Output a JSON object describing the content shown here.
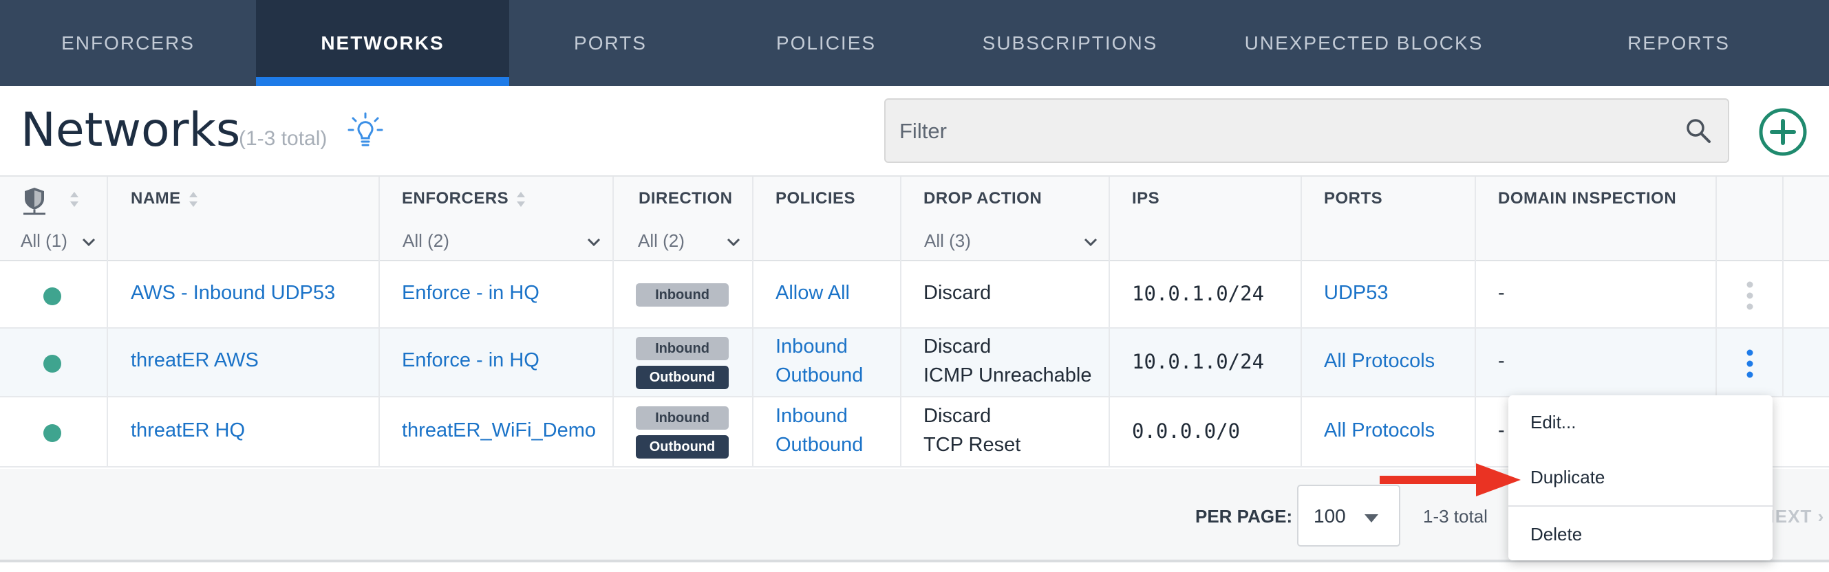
{
  "nav": {
    "tabs": [
      {
        "label": "ENFORCERS"
      },
      {
        "label": "NETWORKS",
        "active": true
      },
      {
        "label": "PORTS"
      },
      {
        "label": "POLICIES"
      },
      {
        "label": "SUBSCRIPTIONS"
      },
      {
        "label": "UNEXPECTED BLOCKS"
      },
      {
        "label": "REPORTS"
      }
    ]
  },
  "header": {
    "title": "Networks",
    "count": "(1-3 total)",
    "filter_placeholder": "Filter"
  },
  "table": {
    "columns": {
      "name": "NAME",
      "enforcers": "ENFORCERS",
      "direction": "DIRECTION",
      "policies": "POLICIES",
      "drop_action": "DROP ACTION",
      "ips": "IPS",
      "ports": "PORTS",
      "domain_inspection": "DOMAIN INSPECTION"
    },
    "filters": {
      "status": "All (1)",
      "enforcers": "All (2)",
      "direction": "All (2)",
      "drop_action": "All (3)"
    },
    "rows": [
      {
        "name": "AWS - Inbound UDP53",
        "enforcer": "Enforce - in HQ",
        "direction": [
          "Inbound"
        ],
        "policies": [
          "Allow All"
        ],
        "drop_action": [
          "Discard"
        ],
        "ips": "10.0.1.0/24",
        "ports": "UDP53",
        "domain_inspection": "-"
      },
      {
        "name": "threatER AWS",
        "enforcer": "Enforce - in HQ",
        "direction": [
          "Inbound",
          "Outbound"
        ],
        "policies": [
          "Inbound",
          "Outbound"
        ],
        "drop_action": [
          "Discard",
          "ICMP Unreachable"
        ],
        "ips": "10.0.1.0/24",
        "ports": "All Protocols",
        "domain_inspection": "-"
      },
      {
        "name": "threatER HQ",
        "enforcer": "threatER_WiFi_Demo",
        "direction": [
          "Inbound",
          "Outbound"
        ],
        "policies": [
          "Inbound",
          "Outbound"
        ],
        "drop_action": [
          "Discard",
          "TCP Reset"
        ],
        "ips": "0.0.0.0/0",
        "ports": "All Protocols",
        "domain_inspection": "-"
      }
    ]
  },
  "footer": {
    "per_page_label": "PER PAGE:",
    "per_page_value": "100",
    "total": "1-3 total",
    "next_label": "NEXT"
  },
  "context_menu": {
    "items": [
      {
        "label": "Edit..."
      },
      {
        "label": "Duplicate"
      },
      {
        "label": "Delete"
      }
    ]
  },
  "colors": {
    "nav_bg": "#35475e",
    "nav_active_bg": "#233246",
    "nav_active_underline": "#1e7be8",
    "link": "#1b73c8",
    "status_dot": "#3fa48f",
    "add_button": "#1f8a6e",
    "annotation_arrow": "#ea3323"
  }
}
